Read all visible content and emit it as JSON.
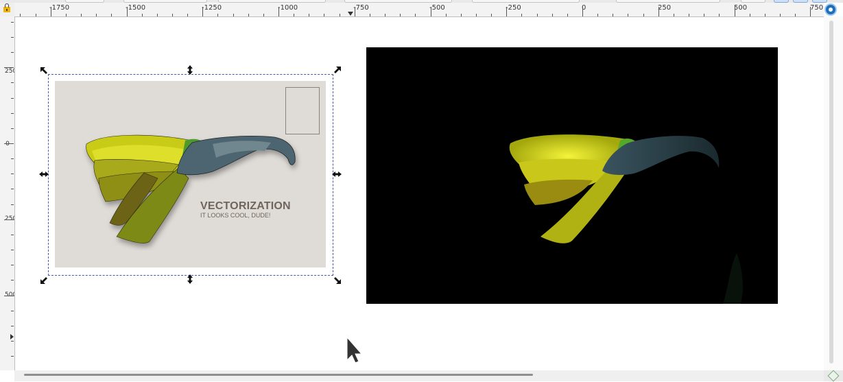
{
  "rulers": {
    "horizontal": [
      "-1750",
      "-1500",
      "-1250",
      "-1000",
      "-750",
      "-500",
      "-250",
      "0",
      "250",
      "500",
      "750"
    ],
    "vertical": [
      "250",
      "0",
      "250",
      "500"
    ]
  },
  "postcard": {
    "title": "VECTORIZATION",
    "subtitle": "IT LOOKS COOL, DUDE!"
  }
}
